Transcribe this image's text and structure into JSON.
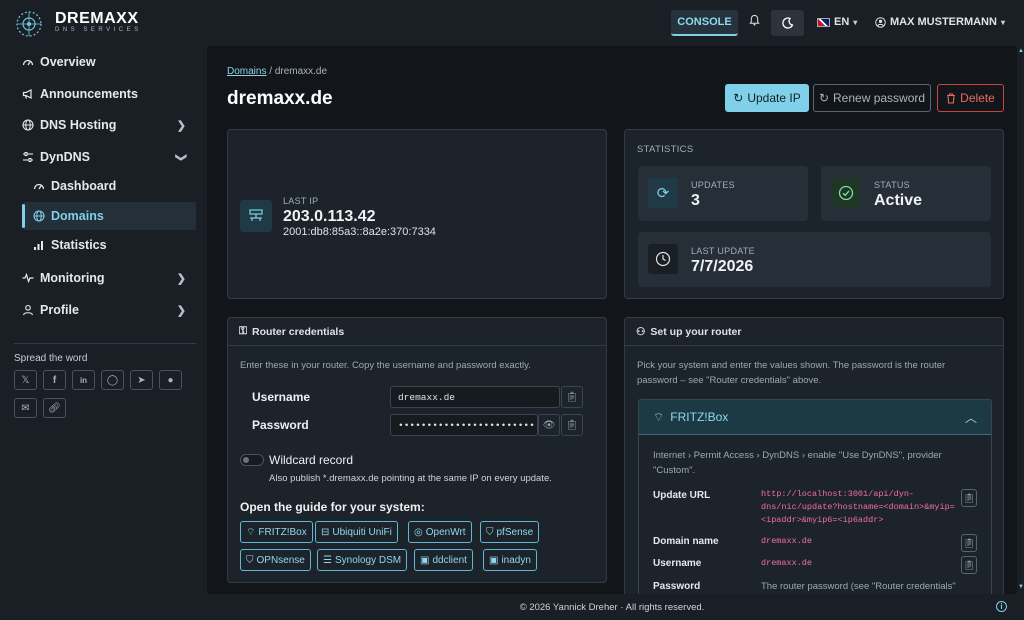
{
  "brand": {
    "name": "DREMAXX",
    "sub": "DNS SERVICES"
  },
  "topbar": {
    "console": "CONSOLE",
    "lang": "EN",
    "user": "MAX MUSTERMANN"
  },
  "sidebar": {
    "items": [
      {
        "label": "Overview",
        "icon": "gauge-icon"
      },
      {
        "label": "Announcements",
        "icon": "megaphone-icon"
      },
      {
        "label": "DNS Hosting",
        "icon": "globe-icon"
      },
      {
        "label": "DynDNS",
        "icon": "sliders-icon"
      },
      {
        "label": "Dashboard",
        "icon": "gauge-icon"
      },
      {
        "label": "Domains",
        "icon": "globe-icon"
      },
      {
        "label": "Statistics",
        "icon": "bar-chart-icon"
      },
      {
        "label": "Monitoring",
        "icon": "pulse-icon"
      },
      {
        "label": "Profile",
        "icon": "user-icon"
      }
    ],
    "spread": "Spread the word"
  },
  "breadcrumb": {
    "link": "Domains",
    "sep": "/",
    "current": "dremaxx.de"
  },
  "title": "dremaxx.de",
  "actions": {
    "update": "Update IP",
    "renew": "Renew password",
    "delete": "Delete"
  },
  "ip": {
    "label": "LAST IP",
    "v4": "203.0.113.42",
    "v6": "2001:db8:85a3::8a2e:370:7334"
  },
  "stats": {
    "heading": "STATISTICS",
    "updates_label": "UPDATES",
    "updates": "3",
    "status_label": "STATUS",
    "status": "Active",
    "last_label": "LAST UPDATE",
    "last": "7/7/2026"
  },
  "creds": {
    "title": "Router credentials",
    "hint": "Enter these in your router. Copy the username and password exactly.",
    "user_label": "Username",
    "user": "dremaxx.de",
    "pass_label": "Password",
    "pass": "••••••••••••••••••••••••",
    "wild_label": "Wildcard record",
    "wild_hint": "Also publish *.dremaxx.de pointing at the same IP on every update.",
    "guide": "Open the guide for your system:",
    "chips": [
      "FRITZ!Box",
      "Ubiquiti UniFi",
      "OpenWrt",
      "pfSense",
      "OPNsense",
      "Synology DSM",
      "ddclient",
      "inadyn"
    ]
  },
  "setup": {
    "title": "Set up your router",
    "hint1": "Pick your system and enter the values shown. The password is the router",
    "hint2": "password – see \"Router credentials\" above.",
    "acc_title": "FRITZ!Box",
    "path1": "Internet › Permit Access › DynDNS › enable \"Use DynDNS\", provider",
    "path2": "\"Custom\".",
    "rows": [
      {
        "label": "Update URL",
        "value": "http://localhost:3001/api/dyn-dns/nic/update?hostname=<domain>&myip=<ipaddr>&myip6=<ip6addr>"
      },
      {
        "label": "Domain name",
        "value": "dremaxx.de"
      },
      {
        "label": "Username",
        "value": "dremaxx.de"
      },
      {
        "label": "Password",
        "value": "The router password (see \"Router credentials\""
      }
    ]
  },
  "footer": "© 2026 Yannick Dreher · All rights reserved."
}
